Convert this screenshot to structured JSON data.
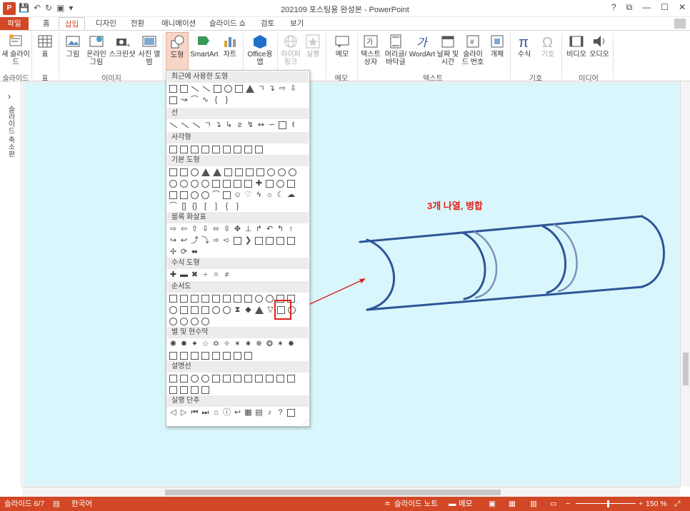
{
  "window": {
    "title": "202109 포스팅용 완성본 - PowerPoint",
    "buttons": [
      "?",
      "⧉",
      "—",
      "☐",
      "✕"
    ]
  },
  "tabs": [
    {
      "label": "파일",
      "active": false
    },
    {
      "label": "홈",
      "active": false
    },
    {
      "label": "삽입",
      "active": true
    },
    {
      "label": "디자인",
      "active": false
    },
    {
      "label": "전환",
      "active": false
    },
    {
      "label": "애니메이션",
      "active": false
    },
    {
      "label": "슬라이드 쇼",
      "active": false
    },
    {
      "label": "검토",
      "active": false
    },
    {
      "label": "보기",
      "active": false
    }
  ],
  "ribbon": {
    "new_slide": "새 슬라이드",
    "table": "표",
    "picture": "그림",
    "online_picture": "온라인 그림",
    "screenshot": "스크린샷",
    "photo_album": "사진 앨범",
    "shapes": "도형",
    "smartart": "SmartArt",
    "chart": "차트",
    "office_app": "Office용 앱",
    "hyperlink": "하이퍼링크",
    "action": "실행",
    "memo": "메모",
    "textbox": "텍스트 상자",
    "header_footer": "머리글/바닥글",
    "wordart": "WordArt",
    "date_time": "날짜 및 시간",
    "slide_number": "슬라이드 번호",
    "object": "개체",
    "equation": "수식",
    "symbol": "기호",
    "video": "비디오",
    "audio": "오디오",
    "groups": {
      "slides": "슬라이드",
      "tables": "표",
      "images": "이미지",
      "comments": "메모",
      "text": "텍스트",
      "symbols": "기호",
      "media": "미디어"
    }
  },
  "leftpanel": {
    "label": "슬라이드 축소판"
  },
  "shapes_menu": {
    "sections": [
      "최근에 사용한 도형",
      "선",
      "사각형",
      "기본 도형",
      "블록 화살표",
      "수식 도형",
      "순서도",
      "별 및 현수막",
      "설명선",
      "실행 단추"
    ]
  },
  "slide": {
    "caption": "3개 나열, 병합"
  },
  "statusbar": {
    "slide_info": "슬라이드 6/7",
    "language": "한국어",
    "notes": "슬라이드 노트",
    "comments": "메모",
    "zoom": "150 %"
  },
  "colors": {
    "accent": "#d24726",
    "slide_bg": "#d8f6fc",
    "cylinder_stroke": "#2e5596",
    "cylinder_band": "#7a95b8",
    "annotation": "#e0201a"
  }
}
